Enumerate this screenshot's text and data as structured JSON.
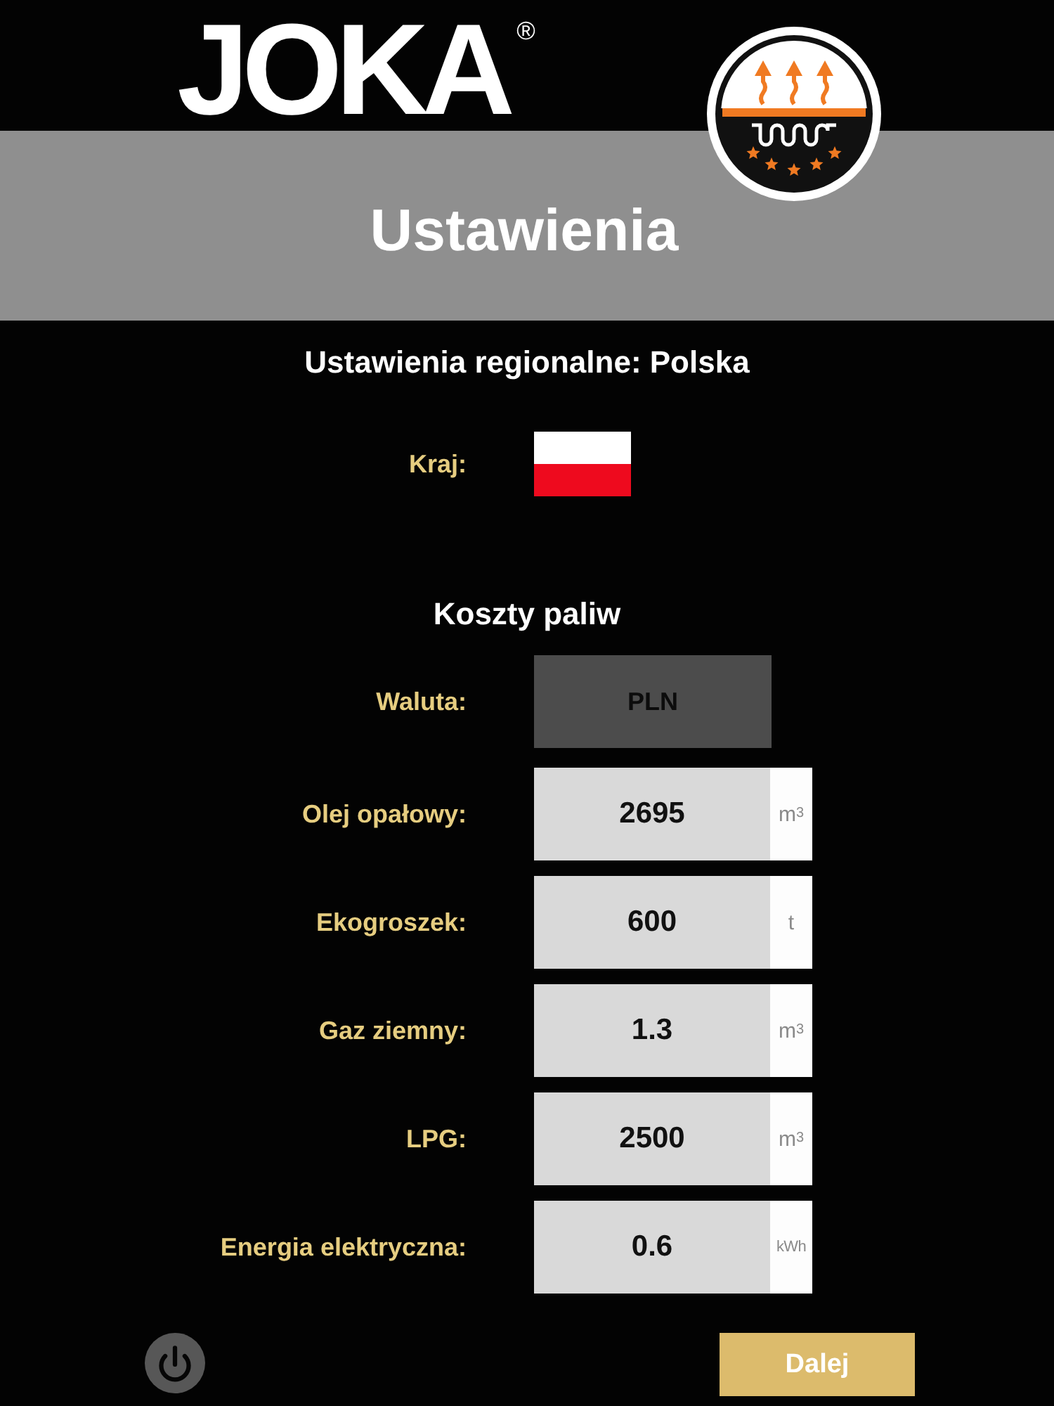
{
  "header": {
    "logo": "JOKA$^{®}$",
    "title": "Ustawienia"
  },
  "regional": {
    "heading": "Ustawienia regionalne: Polska",
    "country_label": "Kraj:"
  },
  "fuel_costs": {
    "heading": "Koszty paliw",
    "currency": {
      "label": "Waluta:",
      "value": "PLN"
    },
    "fuels": [
      {
        "label": "Olej opałowy:",
        "value": "2695",
        "unit": "m$^{3}$"
      },
      {
        "label": "Ekogroszek:",
        "value": "600",
        "unit": "t"
      },
      {
        "label": "Gaz ziemny:",
        "value": "1.3",
        "unit": "m$^{3}$"
      },
      {
        "label": "LPG:",
        "value": "2500",
        "unit": "m$^{3}$"
      },
      {
        "label": "Energia elektryczna:",
        "value": "0.6",
        "unit": "kWh"
      }
    ]
  },
  "footer": {
    "next_button": "Dalej"
  }
}
